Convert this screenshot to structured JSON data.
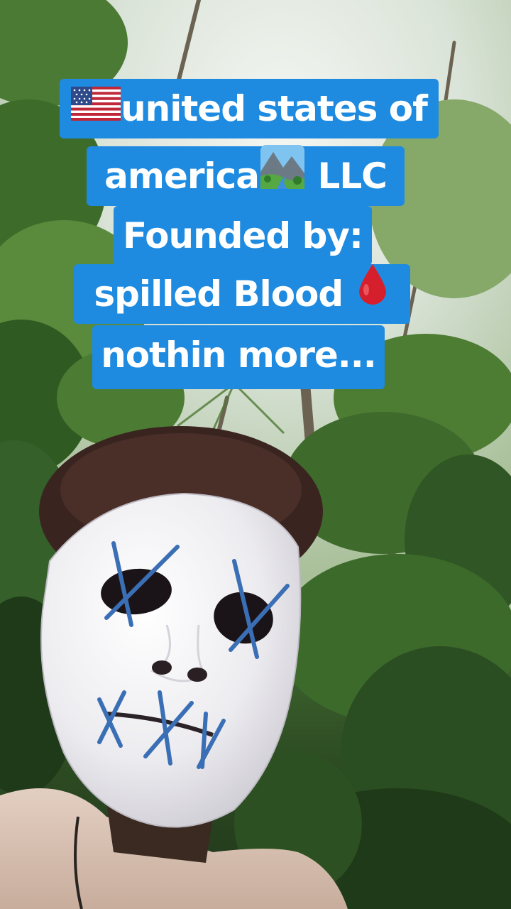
{
  "caption": {
    "lines": [
      {
        "text": "united states of",
        "emoji_before": "us-flag-emoji"
      },
      {
        "text": "america",
        "emoji_after": "national-park-emoji",
        "suffix": " LLC"
      },
      {
        "text": "Founded by:"
      },
      {
        "text": "spilled Blood ",
        "emoji_after": "drop-of-blood-emoji"
      },
      {
        "text": "nothin more..."
      }
    ],
    "background_color": "#1e8be0",
    "text_color": "#ffffff"
  },
  "photo": {
    "subject": "person wearing white stitched purge mask in front of tropical trees",
    "mask_color": "#efeff1",
    "stitch_color": "#3a6fb5",
    "hoodie_color": "#d9c2b4"
  }
}
